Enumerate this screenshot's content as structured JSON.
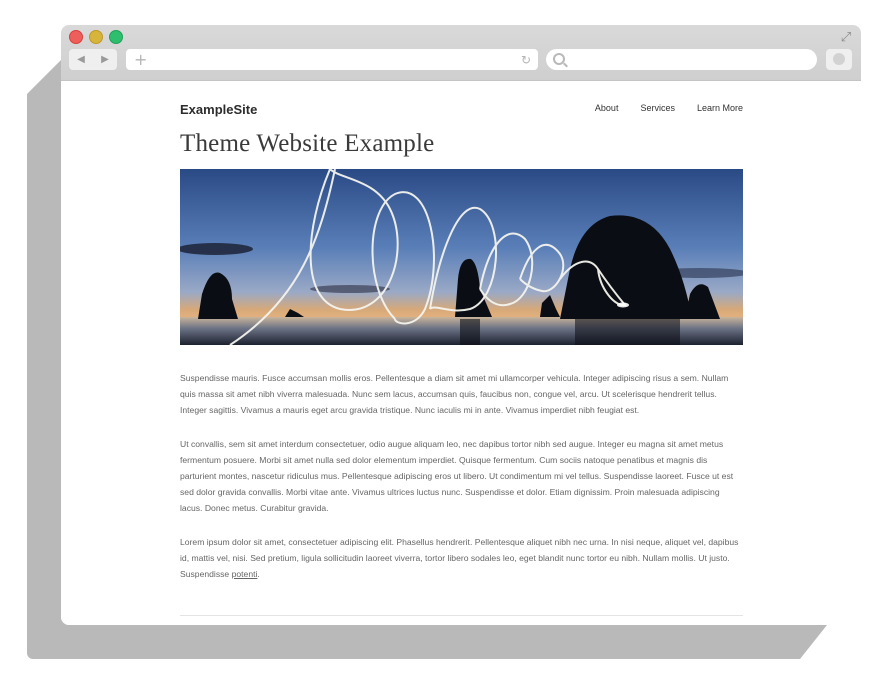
{
  "browser": {
    "back_glyph": "◀",
    "forward_glyph": "▶",
    "new_tab_glyph": "+",
    "reload_glyph": "↻",
    "expand_glyph": "⤢",
    "url": "",
    "search_placeholder": ""
  },
  "site": {
    "logo": "ExampleSite",
    "nav": [
      "About",
      "Services",
      "Learn More"
    ],
    "title": "Theme Website Example",
    "paragraphs": [
      "Suspendisse mauris. Fusce accumsan mollis eros. Pellentesque a diam sit amet mi ullamcorper vehicula. Integer adipiscing risus a sem. Nullam quis massa sit amet nibh viverra malesuada. Nunc sem lacus, accumsan quis, faucibus non, congue vel, arcu. Ut scelerisque hendrerit tellus. Integer sagittis. Vivamus a mauris eget arcu gravida tristique. Nunc iaculis mi in ante. Vivamus imperdiet nibh feugiat est.",
      "Ut convallis, sem sit amet interdum consectetuer, odio augue aliquam leo, nec dapibus tortor nibh sed augue. Integer eu magna sit amet metus fermentum posuere. Morbi sit amet nulla sed dolor elementum imperdiet. Quisque fermentum. Cum sociis natoque penatibus et magnis dis parturient montes, nascetur ridiculus mus. Pellentesque adipiscing eros ut libero. Ut condimentum mi vel tellus. Suspendisse laoreet. Fusce ut est sed dolor gravida convallis. Morbi vitae ante. Vivamus ultrices luctus nunc. Suspendisse et dolor. Etiam dignissim. Proin malesuada adipiscing lacus. Donec metus. Curabitur gravida.",
      "Lorem ipsum dolor sit amet, consectetuer adipiscing elit. Phasellus hendrerit. Pellentesque aliquet nibh nec urna. In nisi neque, aliquet vel, dapibus id, mattis vel, nisi. Sed pretium, ligula sollicitudin laoreet viverra, tortor libero sodales leo, eget blandit nunc tortor eu nibh. Nullam mollis. Ut justo. Suspendisse"
    ],
    "last_link": "potenti",
    "last_suffix": "."
  },
  "colors": {
    "close": "#ee5f5b",
    "minimize": "#d7b43b",
    "zoom": "#2dbf6d",
    "chrome": "#d4d4d4",
    "shadow": "#b9b9b9"
  }
}
